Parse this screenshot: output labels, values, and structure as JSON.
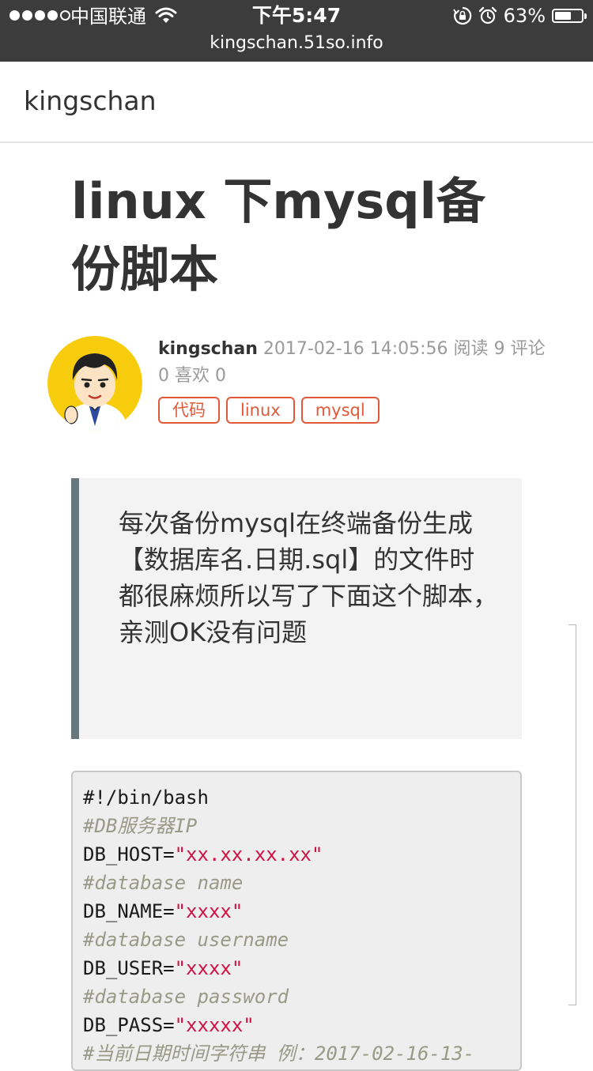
{
  "status_bar": {
    "carrier": "中国联通",
    "time": "下午5:47",
    "battery_percent": "63%",
    "battery_level": 0.63,
    "url": "kingschan.51so.info",
    "icons": [
      "signal-dots-icon",
      "wifi-icon",
      "orientation-lock-icon",
      "alarm-icon",
      "battery-icon"
    ]
  },
  "navbar": {
    "brand": "kingschan"
  },
  "article": {
    "title": "linux 下mysql备份脚本",
    "author": "kingschan",
    "date": "2017-02-16 14:05:56",
    "read_label": "阅读",
    "read_count": "9",
    "comment_label": "评论",
    "comment_count": "0",
    "like_label": "喜欢",
    "like_count": "0",
    "tags": [
      "代码",
      "linux",
      "mysql"
    ],
    "quote": "每次备份mysql在终端备份生成【数据库名.日期.sql】的文件时都很麻烦所以写了下面这个脚本，亲测OK没有问题"
  },
  "code": {
    "lines": [
      {
        "type": "plain",
        "text": "#!/bin/bash"
      },
      {
        "type": "comment",
        "text": "#DB服务器IP"
      },
      {
        "type": "assign",
        "key": "DB_HOST=",
        "value": "\"xx.xx.xx.xx\""
      },
      {
        "type": "comment",
        "text": "#database name"
      },
      {
        "type": "assign",
        "key": "DB_NAME=",
        "value": "\"xxxx\""
      },
      {
        "type": "comment",
        "text": "#database username"
      },
      {
        "type": "assign",
        "key": "DB_USER=",
        "value": "\"xxxx\""
      },
      {
        "type": "comment",
        "text": "#database password"
      },
      {
        "type": "assign",
        "key": "DB_PASS=",
        "value": "\"xxxxx\""
      },
      {
        "type": "comment",
        "text": "#当前日期时间字符串 例：2017-02-16-13-"
      }
    ]
  },
  "colors": {
    "status_bar_bg": "#3c3c3c",
    "tag_accent": "#e05a3a",
    "quote_border": "#66777d",
    "code_string": "#d01040",
    "code_comment": "#999988"
  }
}
